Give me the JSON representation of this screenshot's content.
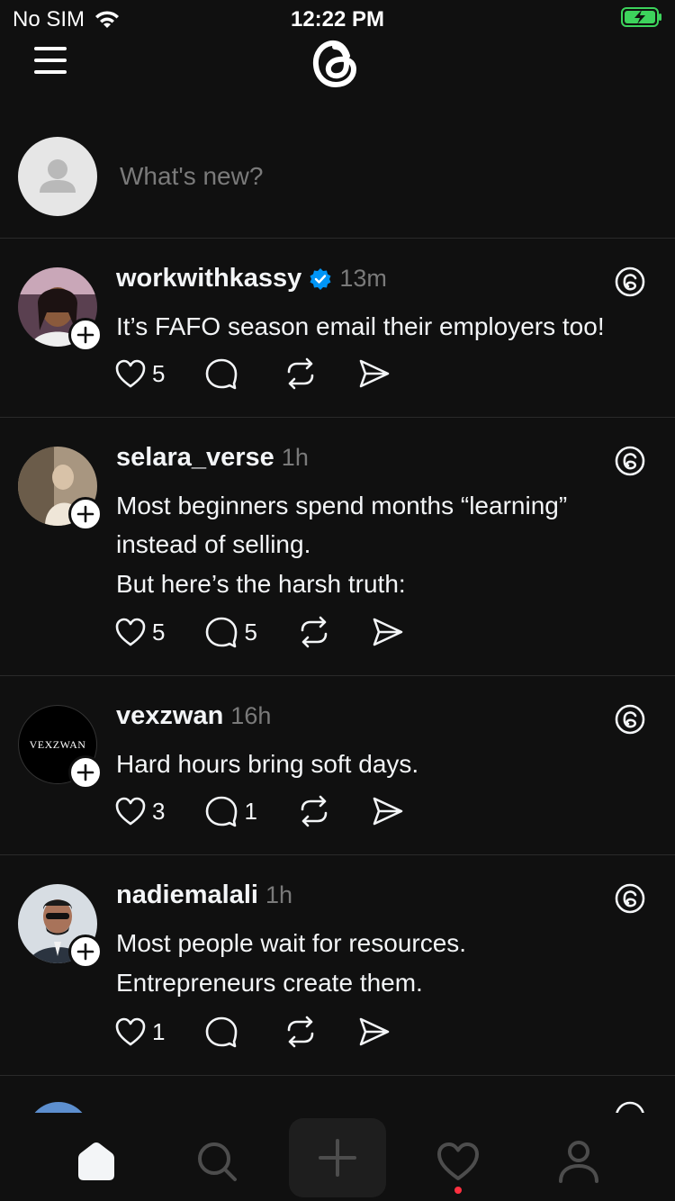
{
  "status_bar": {
    "carrier": "No SIM",
    "time": "12:22 PM"
  },
  "composer": {
    "placeholder": "What's new?"
  },
  "posts": [
    {
      "username": "workwithkassy",
      "verified": true,
      "time": "13m",
      "lines": [
        "It’s FAFO season email their employers too!"
      ],
      "likes": "5",
      "replies": ""
    },
    {
      "username": "selara_verse",
      "verified": false,
      "time": "1h",
      "lines": [
        "Most beginners spend months “learning” instead of selling.",
        "But here’s the harsh truth:"
      ],
      "likes": "5",
      "replies": "5"
    },
    {
      "username": "vexzwan",
      "verified": false,
      "time": "16h",
      "avatar_text": "VEXZWAN",
      "lines": [
        "Hard hours bring soft days."
      ],
      "likes": "3",
      "replies": "1"
    },
    {
      "username": "nadiemalali",
      "verified": false,
      "time": "1h",
      "lines": [
        "Most people wait for resources.",
        "Entrepreneurs create them."
      ],
      "likes": "1",
      "replies": ""
    }
  ],
  "tabbar": {
    "items": [
      "home-icon",
      "search-icon",
      "plus-icon",
      "heart-icon",
      "profile-icon"
    ],
    "active": "home-icon",
    "notification_color": "#ff3040"
  },
  "colors": {
    "background": "#101010",
    "text": "#f3f5f7",
    "secondary": "#7a7a7a",
    "verified": "#0095f6"
  }
}
